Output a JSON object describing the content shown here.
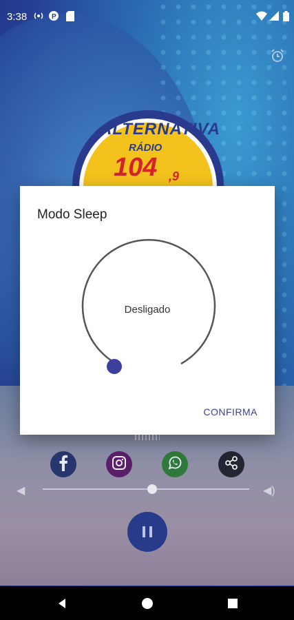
{
  "status_bar": {
    "time": "3:38"
  },
  "logo": {
    "name": "ALTERNATIVA",
    "label": "RÁDIO",
    "freq": "104",
    "freq_decimal": ",9"
  },
  "dialog": {
    "title": "Modo Sleep",
    "timer_value": "Desligado",
    "confirm_label": "CONFIRMA"
  },
  "social": [
    "facebook-icon",
    "instagram-icon",
    "whatsapp-icon",
    "share-icon"
  ],
  "colors": {
    "accent": "#3a3f9a",
    "knob": "#3c3f9c",
    "facebook": "#28366f",
    "instagram": "#5a1f6a",
    "whatsapp": "#2f7a3a",
    "share": "#222633"
  }
}
